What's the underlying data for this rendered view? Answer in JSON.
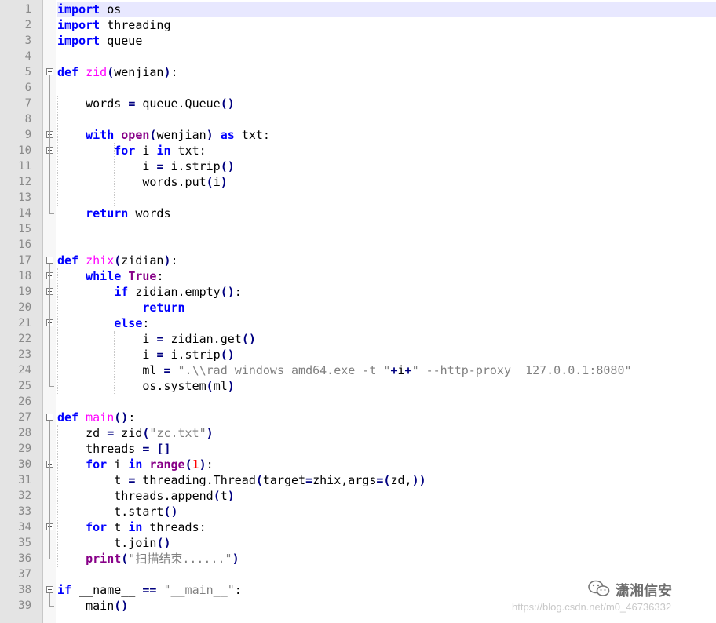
{
  "editor": {
    "current_line": 1,
    "lines": [
      [
        [
          "kw",
          "import"
        ],
        [
          "t",
          " os"
        ]
      ],
      [
        [
          "kw",
          "import"
        ],
        [
          "t",
          " threading"
        ]
      ],
      [
        [
          "kw",
          "import"
        ],
        [
          "t",
          " queue"
        ]
      ],
      [],
      [
        [
          "kw",
          "def"
        ],
        [
          "t",
          " "
        ],
        [
          "fn",
          "zid"
        ],
        [
          "op",
          "("
        ],
        [
          "t",
          "wenjian"
        ],
        [
          "op",
          ")"
        ],
        [
          "t",
          ":"
        ]
      ],
      [],
      [
        [
          "t",
          "    words "
        ],
        [
          "op",
          "="
        ],
        [
          "t",
          " queue.Queue"
        ],
        [
          "op",
          "()"
        ]
      ],
      [],
      [
        [
          "t",
          "    "
        ],
        [
          "kw",
          "with"
        ],
        [
          "t",
          " "
        ],
        [
          "kw2",
          "open"
        ],
        [
          "op",
          "("
        ],
        [
          "t",
          "wenjian"
        ],
        [
          "op",
          ")"
        ],
        [
          "t",
          " "
        ],
        [
          "kw",
          "as"
        ],
        [
          "t",
          " txt:"
        ]
      ],
      [
        [
          "t",
          "        "
        ],
        [
          "kw",
          "for"
        ],
        [
          "t",
          " i "
        ],
        [
          "kw",
          "in"
        ],
        [
          "t",
          " txt:"
        ]
      ],
      [
        [
          "t",
          "            i "
        ],
        [
          "op",
          "="
        ],
        [
          "t",
          " i.strip"
        ],
        [
          "op",
          "()"
        ]
      ],
      [
        [
          "t",
          "            words.put"
        ],
        [
          "op",
          "("
        ],
        [
          "t",
          "i"
        ],
        [
          "op",
          ")"
        ]
      ],
      [],
      [
        [
          "t",
          "    "
        ],
        [
          "kw",
          "return"
        ],
        [
          "t",
          " words"
        ]
      ],
      [],
      [],
      [
        [
          "kw",
          "def"
        ],
        [
          "t",
          " "
        ],
        [
          "fn",
          "zhix"
        ],
        [
          "op",
          "("
        ],
        [
          "t",
          "zidian"
        ],
        [
          "op",
          ")"
        ],
        [
          "t",
          ":"
        ]
      ],
      [
        [
          "t",
          "    "
        ],
        [
          "kw",
          "while"
        ],
        [
          "t",
          " "
        ],
        [
          "kw2",
          "True"
        ],
        [
          "t",
          ":"
        ]
      ],
      [
        [
          "t",
          "        "
        ],
        [
          "kw",
          "if"
        ],
        [
          "t",
          " zidian.empty"
        ],
        [
          "op",
          "()"
        ],
        [
          "t",
          ":"
        ]
      ],
      [
        [
          "t",
          "            "
        ],
        [
          "kw",
          "return"
        ]
      ],
      [
        [
          "t",
          "        "
        ],
        [
          "kw",
          "else"
        ],
        [
          "t",
          ":"
        ]
      ],
      [
        [
          "t",
          "            i "
        ],
        [
          "op",
          "="
        ],
        [
          "t",
          " zidian.get"
        ],
        [
          "op",
          "()"
        ]
      ],
      [
        [
          "t",
          "            i "
        ],
        [
          "op",
          "="
        ],
        [
          "t",
          " i.strip"
        ],
        [
          "op",
          "()"
        ]
      ],
      [
        [
          "t",
          "            ml "
        ],
        [
          "op",
          "="
        ],
        [
          "t",
          " "
        ],
        [
          "str",
          "\".\\\\rad_windows_amd64.exe -t \""
        ],
        [
          "op",
          "+"
        ],
        [
          "t",
          "i"
        ],
        [
          "op",
          "+"
        ],
        [
          "str",
          "\" --http-proxy  127.0.0.1:8080\""
        ]
      ],
      [
        [
          "t",
          "            os.system"
        ],
        [
          "op",
          "("
        ],
        [
          "t",
          "ml"
        ],
        [
          "op",
          ")"
        ]
      ],
      [],
      [
        [
          "kw",
          "def"
        ],
        [
          "t",
          " "
        ],
        [
          "fn",
          "main"
        ],
        [
          "op",
          "()"
        ],
        [
          "t",
          ":"
        ]
      ],
      [
        [
          "t",
          "    zd "
        ],
        [
          "op",
          "="
        ],
        [
          "t",
          " zid"
        ],
        [
          "op",
          "("
        ],
        [
          "str",
          "\"zc.txt\""
        ],
        [
          "op",
          ")"
        ]
      ],
      [
        [
          "t",
          "    threads "
        ],
        [
          "op",
          "="
        ],
        [
          "t",
          " "
        ],
        [
          "op",
          "[]"
        ]
      ],
      [
        [
          "t",
          "    "
        ],
        [
          "kw",
          "for"
        ],
        [
          "t",
          " i "
        ],
        [
          "kw",
          "in"
        ],
        [
          "t",
          " "
        ],
        [
          "kw2",
          "range"
        ],
        [
          "op",
          "("
        ],
        [
          "num",
          "1"
        ],
        [
          "op",
          ")"
        ],
        [
          "t",
          ":"
        ]
      ],
      [
        [
          "t",
          "        t "
        ],
        [
          "op",
          "="
        ],
        [
          "t",
          " threading.Thread"
        ],
        [
          "op",
          "("
        ],
        [
          "t",
          "target"
        ],
        [
          "op",
          "="
        ],
        [
          "t",
          "zhix,args"
        ],
        [
          "op",
          "=("
        ],
        [
          "t",
          "zd,"
        ],
        [
          "op",
          "))"
        ]
      ],
      [
        [
          "t",
          "        threads.append"
        ],
        [
          "op",
          "("
        ],
        [
          "t",
          "t"
        ],
        [
          "op",
          ")"
        ]
      ],
      [
        [
          "t",
          "        t.start"
        ],
        [
          "op",
          "()"
        ]
      ],
      [
        [
          "t",
          "    "
        ],
        [
          "kw",
          "for"
        ],
        [
          "t",
          " t "
        ],
        [
          "kw",
          "in"
        ],
        [
          "t",
          " threads:"
        ]
      ],
      [
        [
          "t",
          "        t.join"
        ],
        [
          "op",
          "()"
        ]
      ],
      [
        [
          "t",
          "    "
        ],
        [
          "kw2",
          "print"
        ],
        [
          "op",
          "("
        ],
        [
          "str",
          "\"扫描结束......\""
        ],
        [
          "op",
          ")"
        ]
      ],
      [],
      [
        [
          "kw",
          "if"
        ],
        [
          "t",
          " __name__ "
        ],
        [
          "op",
          "=="
        ],
        [
          "t",
          " "
        ],
        [
          "str",
          "\"__main__\""
        ],
        [
          "t",
          ":"
        ]
      ],
      [
        [
          "t",
          "    main"
        ],
        [
          "op",
          "()"
        ]
      ]
    ],
    "fold_markers": [
      5,
      9,
      10,
      17,
      18,
      19,
      21,
      27,
      30,
      34,
      38
    ]
  },
  "watermark": {
    "logo_icon": "wechat-icon",
    "text": "潇湘信安",
    "url": "https://blog.csdn.net/m0_46736332"
  }
}
